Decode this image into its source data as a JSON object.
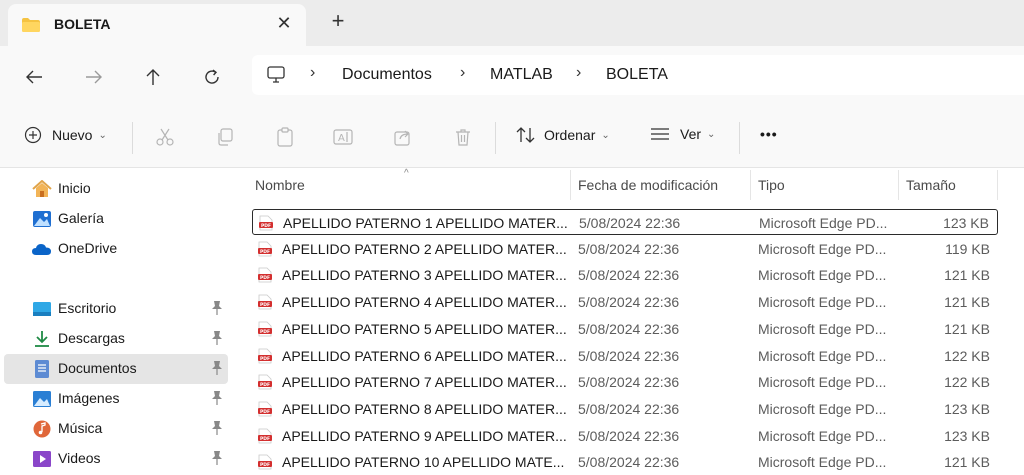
{
  "window": {
    "tab_title": "BOLETA",
    "close_glyph": "✕",
    "new_tab_glyph": "+"
  },
  "nav": {
    "back_icon": "arrow-left-icon",
    "forward_icon": "arrow-right-icon",
    "up_icon": "arrow-up-icon",
    "refresh_icon": "refresh-icon",
    "breadcrumbs": [
      "Documentos",
      "MATLAB",
      "BOLETA"
    ],
    "separator": "›"
  },
  "toolbar": {
    "new_label": "Nuevo",
    "sort_label": "Ordenar",
    "view_label": "Ver",
    "more_label": "•••"
  },
  "sidebar": {
    "items": [
      {
        "label": "Inicio",
        "icon": "home-icon",
        "pinned": false
      },
      {
        "label": "Galería",
        "icon": "gallery-icon",
        "pinned": false
      },
      {
        "label": "OneDrive",
        "icon": "cloud-icon",
        "pinned": false
      },
      {
        "label": "Escritorio",
        "icon": "desktop-icon",
        "pinned": true
      },
      {
        "label": "Descargas",
        "icon": "download-icon",
        "pinned": true
      },
      {
        "label": "Documentos",
        "icon": "documents-icon",
        "pinned": true,
        "active": true
      },
      {
        "label": "Imágenes",
        "icon": "pictures-icon",
        "pinned": true
      },
      {
        "label": "Música",
        "icon": "music-icon",
        "pinned": true
      },
      {
        "label": "Videos",
        "icon": "videos-icon",
        "pinned": true
      }
    ]
  },
  "files": {
    "columns": [
      "Nombre",
      "Fecha de modificación",
      "Tipo",
      "Tamaño"
    ],
    "sort_caret": "^",
    "rows": [
      {
        "name": "APELLIDO PATERNO 1 APELLIDO MATER...",
        "date": "5/08/2024 22:36",
        "type": "Microsoft Edge PD...",
        "size": "123 KB"
      },
      {
        "name": "APELLIDO PATERNO 2 APELLIDO MATER...",
        "date": "5/08/2024 22:36",
        "type": "Microsoft Edge PD...",
        "size": "119 KB"
      },
      {
        "name": "APELLIDO PATERNO 3 APELLIDO MATER...",
        "date": "5/08/2024 22:36",
        "type": "Microsoft Edge PD...",
        "size": "121 KB"
      },
      {
        "name": "APELLIDO PATERNO 4 APELLIDO MATER...",
        "date": "5/08/2024 22:36",
        "type": "Microsoft Edge PD...",
        "size": "121 KB"
      },
      {
        "name": "APELLIDO PATERNO 5 APELLIDO MATER...",
        "date": "5/08/2024 22:36",
        "type": "Microsoft Edge PD...",
        "size": "121 KB"
      },
      {
        "name": "APELLIDO PATERNO 6 APELLIDO MATER...",
        "date": "5/08/2024 22:36",
        "type": "Microsoft Edge PD...",
        "size": "122 KB"
      },
      {
        "name": "APELLIDO PATERNO 7 APELLIDO MATER...",
        "date": "5/08/2024 22:36",
        "type": "Microsoft Edge PD...",
        "size": "122 KB"
      },
      {
        "name": "APELLIDO PATERNO 8 APELLIDO MATER...",
        "date": "5/08/2024 22:36",
        "type": "Microsoft Edge PD...",
        "size": "123 KB"
      },
      {
        "name": "APELLIDO PATERNO 9 APELLIDO MATER...",
        "date": "5/08/2024 22:36",
        "type": "Microsoft Edge PD...",
        "size": "123 KB"
      },
      {
        "name": "APELLIDO PATERNO 10 APELLIDO MATE...",
        "date": "5/08/2024 22:36",
        "type": "Microsoft Edge PD...",
        "size": "121 KB"
      }
    ]
  },
  "colors": {
    "titlebar": "#ececec",
    "surface": "#f9f9f9",
    "folder": "#f5c342",
    "accent": "#0067c0",
    "pdf_red": "#d32f2f"
  }
}
